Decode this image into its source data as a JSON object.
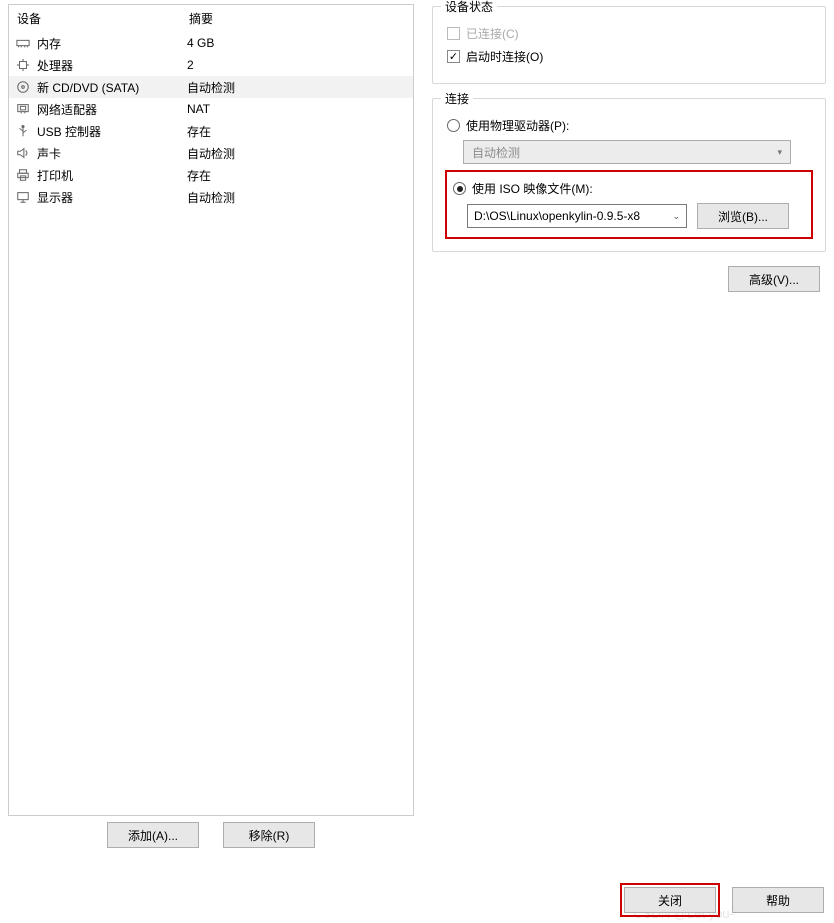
{
  "device_list": {
    "header_device": "设备",
    "header_summary": "摘要",
    "items": [
      {
        "icon": "memory",
        "name": "内存",
        "summary": "4 GB"
      },
      {
        "icon": "cpu",
        "name": "处理器",
        "summary": "2"
      },
      {
        "icon": "disc",
        "name": "新 CD/DVD (SATA)",
        "summary": "自动检测",
        "selected": true
      },
      {
        "icon": "nic",
        "name": "网络适配器",
        "summary": "NAT"
      },
      {
        "icon": "usb",
        "name": "USB 控制器",
        "summary": "存在"
      },
      {
        "icon": "sound",
        "name": "声卡",
        "summary": "自动检测"
      },
      {
        "icon": "printer",
        "name": "打印机",
        "summary": "存在"
      },
      {
        "icon": "display",
        "name": "显示器",
        "summary": "自动检测"
      }
    ]
  },
  "buttons": {
    "add": "添加(A)...",
    "remove": "移除(R)",
    "browse": "浏览(B)...",
    "advanced": "高级(V)...",
    "close": "关闭",
    "help": "帮助"
  },
  "status_group": {
    "legend": "设备状态",
    "connected": "已连接(C)",
    "connect_on_start": "启动时连接(O)"
  },
  "connection_group": {
    "legend": "连接",
    "physical_drive": "使用物理驱动器(P):",
    "physical_drive_value": "自动检测",
    "use_iso": "使用 ISO 映像文件(M):",
    "iso_path": "D:\\OS\\Linux\\openkylin-0.9.5-x8"
  },
  "watermark": "CSDN @Let you-"
}
